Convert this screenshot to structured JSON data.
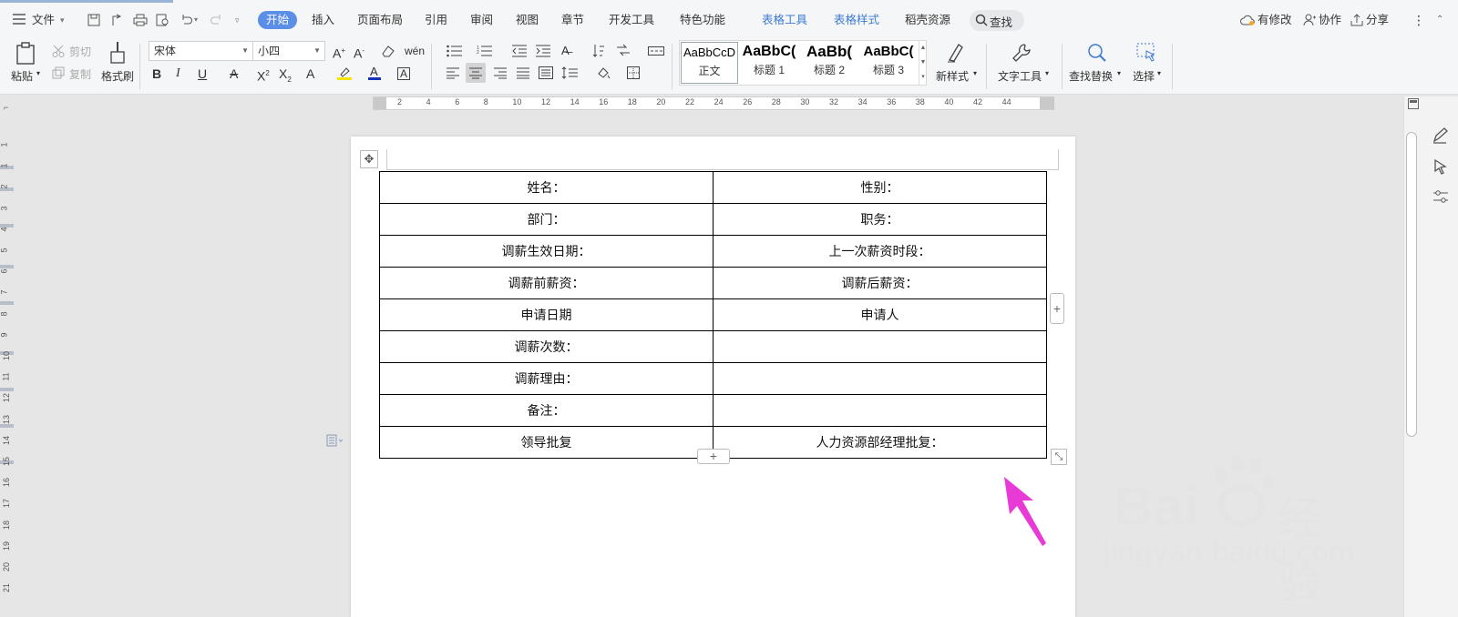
{
  "menubar": {
    "file_label": "文件",
    "tabs": [
      "开始",
      "插入",
      "页面布局",
      "引用",
      "审阅",
      "视图",
      "章节",
      "开发工具",
      "特色功能",
      "表格工具",
      "表格样式",
      "稻壳资源"
    ],
    "search_label": "查找",
    "modified_label": "有修改",
    "collab_label": "协作",
    "share_label": "分享"
  },
  "ribbon": {
    "paste_label": "粘贴",
    "cut_label": "剪切",
    "copy_label": "复制",
    "format_painter_label": "格式刷",
    "font_name": "宋体",
    "font_size": "小四",
    "styles": [
      {
        "preview": "AaBbCcD",
        "name": "正文"
      },
      {
        "preview": "AaBbC(",
        "name": "标题 1"
      },
      {
        "preview": "AaBb(",
        "name": "标题 2"
      },
      {
        "preview": "AaBbC(",
        "name": "标题 3"
      }
    ],
    "new_style_label": "新样式",
    "text_tools_label": "文字工具",
    "find_replace_label": "查找替换",
    "select_label": "选择"
  },
  "ruler": {
    "h_ticks": [
      "2",
      "4",
      "6",
      "8",
      "10",
      "12",
      "14",
      "16",
      "18",
      "20",
      "22",
      "24",
      "26",
      "28",
      "30",
      "32",
      "34",
      "36",
      "38",
      "40",
      "42",
      "44"
    ],
    "v_ticks": [
      "1",
      "1",
      "2",
      "3",
      "4",
      "5",
      "6",
      "7",
      "8",
      "9",
      "10",
      "11",
      "12",
      "13",
      "14",
      "15",
      "16",
      "17",
      "18",
      "19",
      "20",
      "21"
    ]
  },
  "table": {
    "rows": [
      [
        "姓名：",
        "性别："
      ],
      [
        "部门：",
        "职务："
      ],
      [
        "调薪生效日期：",
        "上一次薪资时段："
      ],
      [
        "调薪前薪资：",
        "调薪后薪资："
      ],
      [
        "申请日期",
        "申请人"
      ],
      [
        "调薪次数：",
        ""
      ],
      [
        "调薪理由：",
        ""
      ],
      [
        "备注：",
        ""
      ],
      [
        "领导批复",
        "人力资源部经理批复："
      ]
    ]
  },
  "watermark": {
    "brand": "Bai",
    "brand_suffix": "经验",
    "url": "jingyan.baidu.com"
  },
  "colors": {
    "active_tab": "#5b8ee6",
    "table_tools": "#3d7bd0",
    "arrow": "#e83ad6"
  }
}
